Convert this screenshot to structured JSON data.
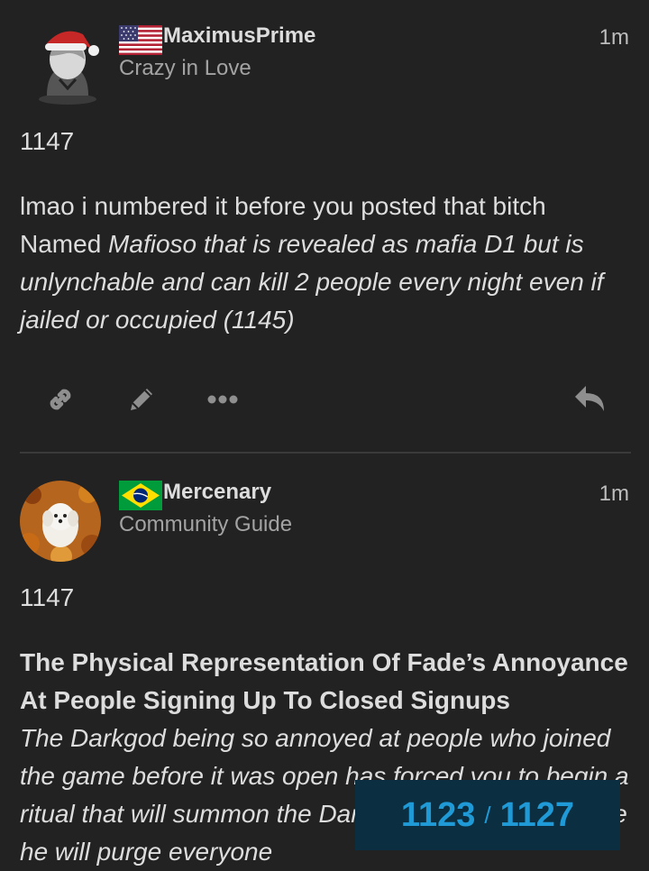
{
  "posts": [
    {
      "username": "MaximusPrime",
      "user_title": "Crazy in Love",
      "time": "1m",
      "flag_icon": "us-flag-icon",
      "number": "1147",
      "body_plain": "lmao i numbered it before you posted that bitch",
      "body_named_prefix": "Named ",
      "body_named_italic": "Mafioso that is revealed as mafia D1 but is unlynchable and can kill 2 people every night even if jailed or occupied (1145)"
    },
    {
      "username": "Mercenary",
      "user_title": "Community Guide",
      "time": "1m",
      "flag_icon": "brazil-flag-icon",
      "number": "1147",
      "body_heading": "The Physical Representation Of Fade’s Annoyance At People Signing Up To Closed Signups",
      "body_italic": "The Darkgod being so annoyed at people who joined the game before it was open has forced you to begin a ritual that will summon the Darkgod to the town, where he will purge everyone"
    }
  ],
  "actions": {
    "icons": [
      "link-icon",
      "edit-icon",
      "more-icon",
      "reply-icon"
    ]
  },
  "progress": {
    "current": "1123",
    "separator": "/",
    "total": "1127"
  },
  "colors": {
    "background": "#222222",
    "text": "#dddddd",
    "muted": "#a3a3a3",
    "accent": "#1f9ad6",
    "progress_bg": "#0b2f40"
  }
}
